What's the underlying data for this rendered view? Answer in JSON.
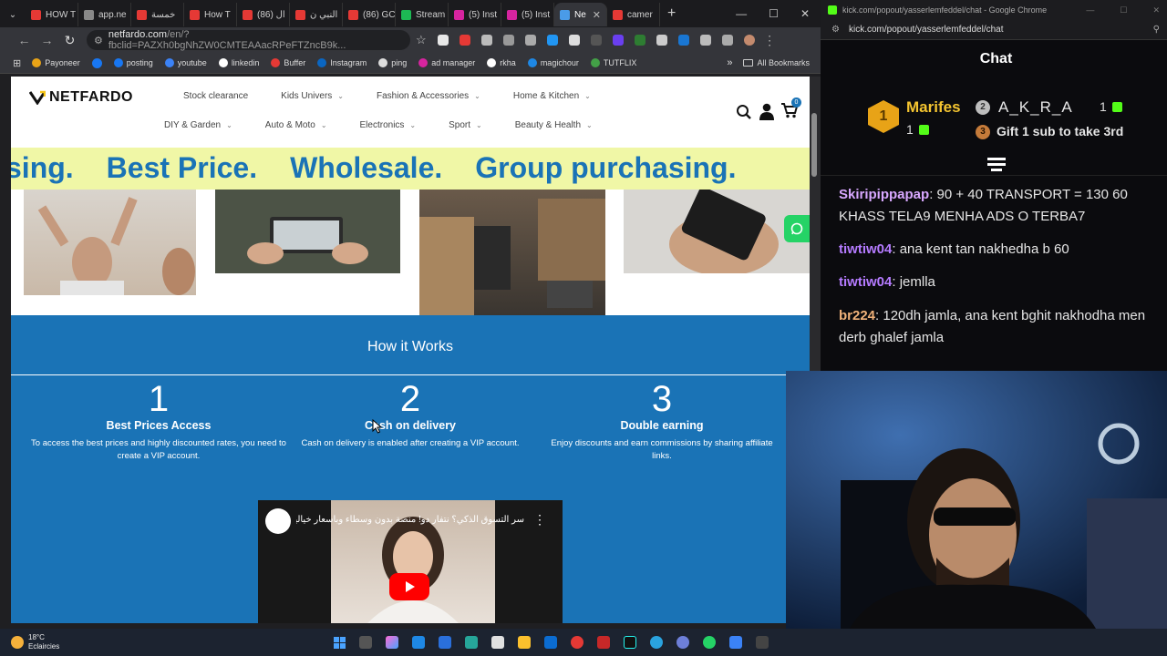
{
  "browser": {
    "tabs": [
      {
        "label": "HOW T",
        "color": "#e53935"
      },
      {
        "label": "app.ne",
        "color": "#888888"
      },
      {
        "label": "خمسة",
        "color": "#e53935"
      },
      {
        "label": "How T",
        "color": "#e53935"
      },
      {
        "label": "ال (86)",
        "color": "#e53935"
      },
      {
        "label": "النبي ن",
        "color": "#e53935"
      },
      {
        "label": "(86) GC",
        "color": "#e53935"
      },
      {
        "label": "Stream",
        "color": "#1db954"
      },
      {
        "label": "(5) Inst",
        "color": "#d6249f"
      },
      {
        "label": "(5) Inst",
        "color": "#d6249f"
      },
      {
        "label": "Ne",
        "color": "#4a9be8"
      },
      {
        "label": "camer",
        "color": "#e53935"
      }
    ],
    "url": "netfardo.com",
    "url_rest": "/en/?fbclid=PAZXh0bgNhZW0CMTEAAacRPeFTZncB9k...",
    "bookmarks": [
      "Payoneer",
      "posting",
      "youtube",
      "linkedin",
      "Buffer",
      "Instagram",
      "ping",
      "ad manager",
      "rkha",
      "magichour",
      "TUTFLIX"
    ],
    "all_bookmarks": "All Bookmarks"
  },
  "site": {
    "logo": "NETFARDO",
    "cart_count": "0",
    "nav_row1": [
      "Stock clearance",
      "Kids Univers",
      "Fashion & Accessories",
      "Home & Kitchen"
    ],
    "nav_row2": [
      "DIY & Garden",
      "Auto & Moto",
      "Electronics",
      "Sport",
      "Beauty & Health"
    ],
    "marquee": [
      "sing.",
      "Best Price.",
      "Wholesale.",
      "Group purchasing."
    ],
    "how_title": "How it Works",
    "steps": [
      {
        "num": "1",
        "title": "Best Prices Access",
        "desc": "To access the best prices and highly discounted rates, you need to create a VIP account."
      },
      {
        "num": "2",
        "title": "Cash on delivery",
        "desc": "Cash on delivery is enabled after creating a VIP account."
      },
      {
        "num": "3",
        "title": "Double earning",
        "desc": "Enjoy discounts and earn commissions by sharing affiliate links."
      }
    ],
    "video_title": "سر التسوق الذكي؟ نتفار دو! منصة بدون وسطاء وبأسعار خيالية"
  },
  "kick": {
    "window_title": "kick.com/popout/yasserlemfeddel/chat - Google Chrome",
    "url": "kick.com/popout/yasserlemfeddel/chat",
    "chat_title": "Chat",
    "leader1": {
      "rank": "1",
      "name": "Marifes",
      "subs": "1"
    },
    "leader2": {
      "rank": "2",
      "name": "A_K_R_A",
      "subs": "1"
    },
    "leader3": {
      "rank": "3",
      "text": "Gift 1 sub to take 3rd"
    },
    "messages": [
      {
        "user": "Skiripippapap",
        "color": "#d8a8ff",
        "text": "90 + 40 TRANSPORT = 130 60 KHASS TELA9 MENHA ADS O TERBA7"
      },
      {
        "user": "tiwtiw04",
        "color": "#b57bff",
        "text": "ana kent tan nakhedha b 60"
      },
      {
        "user": "tiwtiw04",
        "color": "#b57bff",
        "text": "jemlla"
      },
      {
        "user": "br224",
        "color": "#f0b27a",
        "text": "120dh jamla, ana kent bghit nakhodha men derb ghalef jamla"
      }
    ]
  },
  "taskbar": {
    "temp": "18°C",
    "weather": "Eclaircies"
  }
}
